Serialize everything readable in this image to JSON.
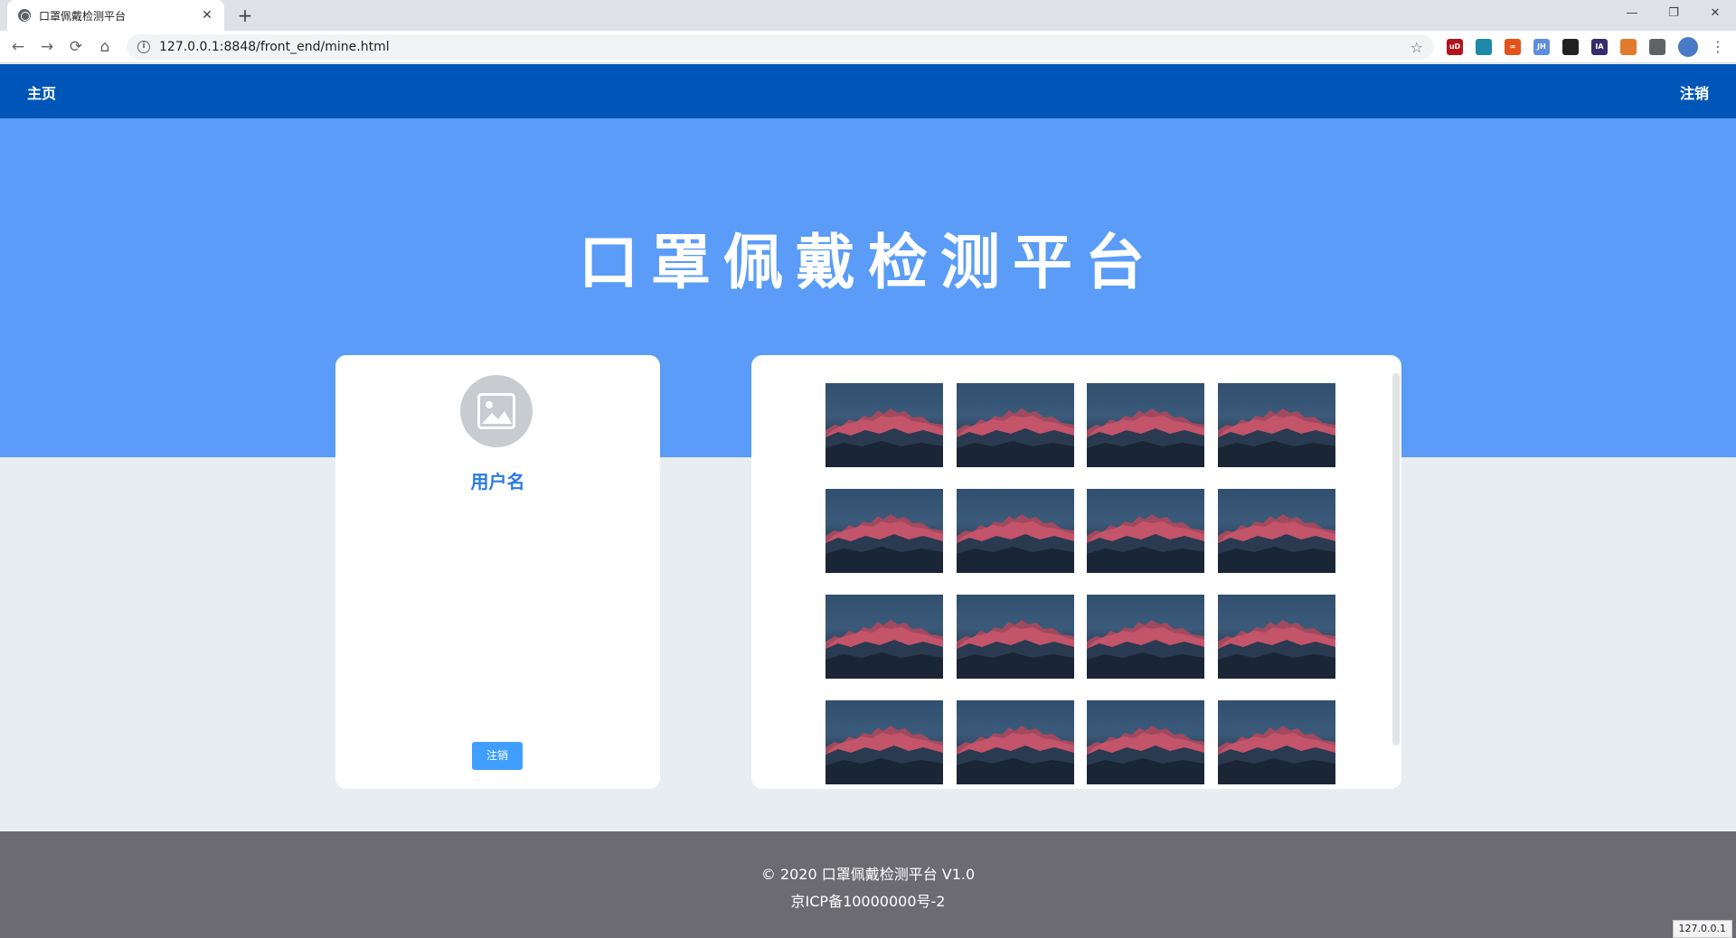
{
  "browser": {
    "tab_title": "口罩佩戴检测平台",
    "tab_close": "✕",
    "new_tab": "+",
    "url": "127.0.0.1:8848/front_end/mine.html",
    "window_controls": {
      "minimize": "—",
      "restore": "❐",
      "close": "✕"
    },
    "nav": {
      "back": "←",
      "forward": "→",
      "reload": "⟳",
      "home": "⌂"
    },
    "extensions": [
      {
        "label": "uD",
        "color": "#b3141c"
      },
      {
        "label": "",
        "color": "#1c8aa8"
      },
      {
        "label": "∞",
        "color": "#e3521b"
      },
      {
        "label": "JH",
        "color": "#5d8de0"
      },
      {
        "label": "",
        "color": "#222222"
      },
      {
        "label": "IA",
        "color": "#352d6b"
      },
      {
        "label": "",
        "color": "#e07a2c"
      },
      {
        "label": "",
        "color": "#5f6368"
      }
    ]
  },
  "navbar": {
    "home": "主页",
    "logout": "注销"
  },
  "hero": {
    "title": "口罩佩戴检测平台"
  },
  "profile": {
    "username": "用户名",
    "logout_button": "注销"
  },
  "gallery": {
    "image_count": 16
  },
  "footer": {
    "line1": "© 2020 口罩佩戴检测平台 V1.0",
    "line2": "京ICP备10000000号-2"
  },
  "status_bar": "127.0.0.1",
  "colors": {
    "navbar": "#0056b8",
    "hero": "#5a9cf7",
    "accent": "#409eff",
    "footer": "#6c6b72"
  }
}
